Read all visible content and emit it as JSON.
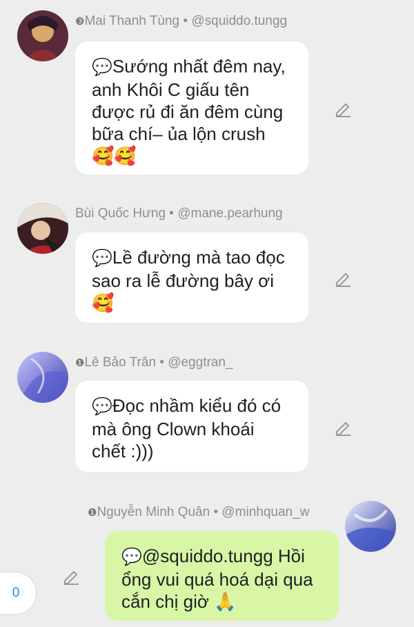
{
  "messages": [
    {
      "badge": "❸",
      "name": "Mai Thanh Tùng",
      "sep": " • ",
      "handle": "@squiddo.tungg",
      "chat_icon": "💬",
      "text": "Sướng nhất đêm nay, anh Khôi C giấu tên được rủ đi ăn đêm cùng bữa chí– ủa lộn crush",
      "emoji": "🥰🥰"
    },
    {
      "badge": "",
      "name": "Bùi Quốc Hưng",
      "sep": " • ",
      "handle": "@mane.pearhung",
      "chat_icon": "💬",
      "text": "Lề đường mà tao đọc sao ra lễ đường bây ơi",
      "emoji": "🥰"
    },
    {
      "badge": "❶",
      "name": "Lê Bảo Trân",
      "sep": " • ",
      "handle": "@eggtran_",
      "chat_icon": "💬",
      "text": "Đọc nhầm kiểu đó có mà ông Clown khoái chết :)))",
      "emoji": ""
    },
    {
      "badge": "❶",
      "name": "Nguyễn Minh Quân",
      "sep": " • ",
      "handle": "@minhquan_w",
      "chat_icon": "💬",
      "text": "@squiddo.tungg Hồi ổng vui quá hoá dại qua cắn chị giờ 🙏",
      "emoji": ""
    }
  ],
  "fab": {
    "count": "0"
  },
  "icons": {
    "edit": "pencil-edit-icon",
    "chat": "speech-bubble-icon"
  },
  "colors": {
    "bubble": "#ffffff",
    "own_bubble": "#d8f6a6",
    "accent": "#1e88e5",
    "background": "#ededed"
  }
}
